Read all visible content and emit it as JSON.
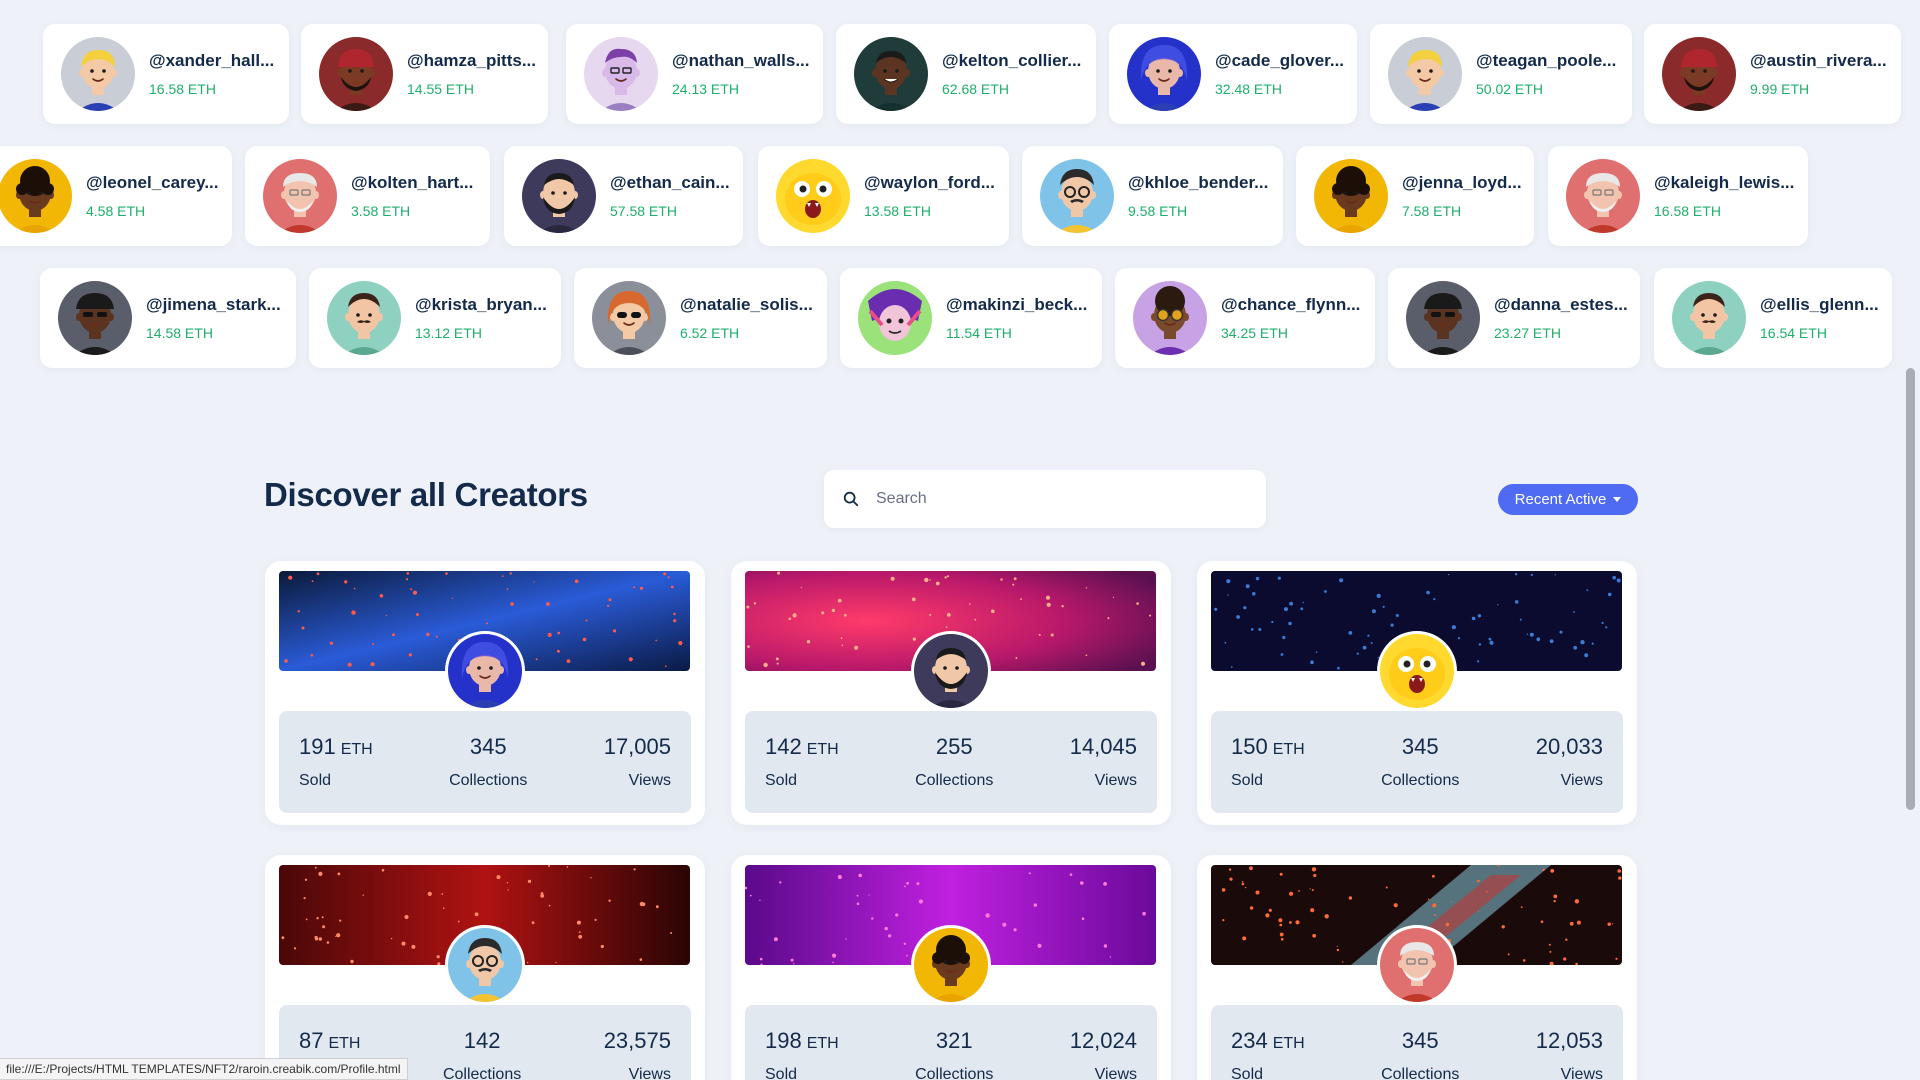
{
  "creators_row1": [
    {
      "handle": "@xander_hall...",
      "eth": "16.58 ETH",
      "avatar": "blond-boy-avatar"
    },
    {
      "handle": "@hamza_pitts...",
      "eth": "14.55 ETH",
      "avatar": "red-beanie-beard-avatar"
    },
    {
      "handle": "@nathan_walls...",
      "eth": "24.13 ETH",
      "avatar": "purple-hair-man-avatar"
    },
    {
      "handle": "@kelton_collier...",
      "eth": "62.68 ETH",
      "avatar": "dark-skin-man-avatar"
    },
    {
      "handle": "@cade_glover...",
      "eth": "32.48 ETH",
      "avatar": "blue-hood-avatar"
    },
    {
      "handle": "@teagan_poole...",
      "eth": "50.02 ETH",
      "avatar": "blond-boy-avatar"
    },
    {
      "handle": "@austin_rivera...",
      "eth": "9.99 ETH",
      "avatar": "red-beanie-beard-avatar"
    }
  ],
  "creators_row2": [
    {
      "handle": "@leonel_carey...",
      "eth": "4.58 ETH",
      "avatar": "curly-woman-avatar"
    },
    {
      "handle": "@kolten_hart...",
      "eth": "3.58 ETH",
      "avatar": "grandpa-avatar"
    },
    {
      "handle": "@ethan_cain...",
      "eth": "57.58 ETH",
      "avatar": "bearded-man-avatar"
    },
    {
      "handle": "@waylon_ford...",
      "eth": "13.58 ETH",
      "avatar": "yellow-dog-avatar"
    },
    {
      "handle": "@khloe_bender...",
      "eth": "9.58 ETH",
      "avatar": "glasses-man-avatar"
    },
    {
      "handle": "@jenna_loyd...",
      "eth": "7.58 ETH",
      "avatar": "curly-woman-avatar"
    },
    {
      "handle": "@kaleigh_lewis...",
      "eth": "16.58 ETH",
      "avatar": "grandpa-avatar"
    }
  ],
  "creators_row3": [
    {
      "handle": "@jimena_stark...",
      "eth": "14.58 ETH",
      "avatar": "cap-sunglasses-avatar"
    },
    {
      "handle": "@krista_bryan...",
      "eth": "13.12 ETH",
      "avatar": "mustache-man-avatar"
    },
    {
      "handle": "@natalie_solis...",
      "eth": "6.52 ETH",
      "avatar": "redhead-sunglasses-avatar"
    },
    {
      "handle": "@makinzi_beck...",
      "eth": "11.54 ETH",
      "avatar": "colorful-art-avatar"
    },
    {
      "handle": "@chance_flynn...",
      "eth": "34.25 ETH",
      "avatar": "purple-glasses-avatar"
    },
    {
      "handle": "@danna_estes...",
      "eth": "23.27 ETH",
      "avatar": "cap-sunglasses-avatar"
    },
    {
      "handle": "@ellis_glenn...",
      "eth": "16.54 ETH",
      "avatar": "mustache-man-avatar"
    }
  ],
  "discover": {
    "title": "Discover all Creators",
    "search_placeholder": "Search",
    "sort_label": "Recent Active",
    "cards": [
      {
        "banner": "blue",
        "avatar": "blue-hood-avatar",
        "sold": "191",
        "unit": "ETH",
        "sold_label": "Sold",
        "collections": "345",
        "collections_label": "Collections",
        "views": "17,005",
        "views_label": "Views"
      },
      {
        "banner": "pink",
        "avatar": "bearded-man-avatar",
        "sold": "142",
        "unit": "ETH",
        "sold_label": "Sold",
        "collections": "255",
        "collections_label": "Collections",
        "views": "14,045",
        "views_label": "Views"
      },
      {
        "banner": "navy",
        "avatar": "yellow-dog-avatar",
        "sold": "150",
        "unit": "ETH",
        "sold_label": "Sold",
        "collections": "345",
        "collections_label": "Collections",
        "views": "20,033",
        "views_label": "Views"
      },
      {
        "banner": "red",
        "avatar": "glasses-man-avatar",
        "sold": "87",
        "unit": "ETH",
        "sold_label": "Sold",
        "collections": "142",
        "collections_label": "Collections",
        "views": "23,575",
        "views_label": "Views"
      },
      {
        "banner": "purple",
        "avatar": "curly-woman-avatar",
        "sold": "198",
        "unit": "ETH",
        "sold_label": "Sold",
        "collections": "321",
        "collections_label": "Collections",
        "views": "12,024",
        "views_label": "Views"
      },
      {
        "banner": "glitch",
        "avatar": "grandpa-avatar",
        "sold": "234",
        "unit": "ETH",
        "sold_label": "Sold",
        "collections": "345",
        "collections_label": "Collections",
        "views": "12,053",
        "views_label": "Views"
      }
    ]
  },
  "status_bar": {
    "url": "file:///E:/Projects/HTML TEMPLATES/NFT2/raroin.creabik.com/Profile.html"
  },
  "colors": {
    "accent": "#4f6bf4",
    "eth_green": "#1eb06b",
    "heading": "#132a4a",
    "page_bg": "#eef2f8"
  }
}
